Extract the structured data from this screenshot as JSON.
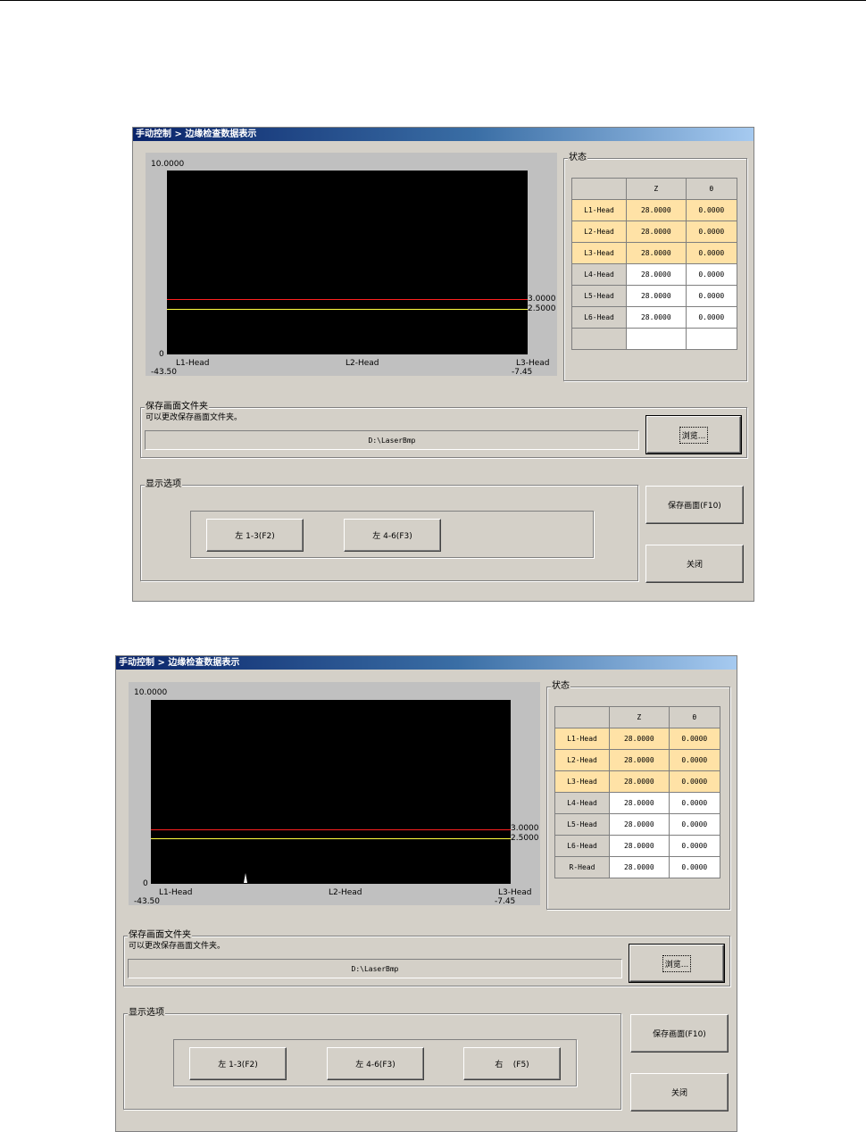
{
  "windows": [
    {
      "title": "手动控制 > 边缘检查数据表示",
      "plot": {
        "y_max": "10.0000",
        "y_min": "0",
        "x_left": "-43.50",
        "x_right": "-7.45",
        "x_labels": [
          "L1-Head",
          "L2-Head",
          "L3-Head"
        ],
        "red_line_value": "3.0000",
        "yellow_line_value": "2.5000",
        "red_color": "#ff2020",
        "yellow_color": "#ffff40"
      },
      "status": {
        "label": "状态",
        "col_z": "Z",
        "col_theta": "θ",
        "rows": [
          {
            "head": "L1-Head",
            "z": "28.0000",
            "t": "0.0000"
          },
          {
            "head": "L2-Head",
            "z": "28.0000",
            "t": "0.0000"
          },
          {
            "head": "L3-Head",
            "z": "28.0000",
            "t": "0.0000"
          },
          {
            "head": "L4-Head",
            "z": "28.0000",
            "t": "0.0000"
          },
          {
            "head": "L5-Head",
            "z": "28.0000",
            "t": "0.0000"
          },
          {
            "head": "L6-Head",
            "z": "28.0000",
            "t": "0.0000"
          },
          {
            "head": "",
            "z": "",
            "t": ""
          }
        ]
      },
      "save_folder": {
        "label": "保存画面文件夹",
        "hint": "可以更改保存画面文件夹。",
        "path": "D:\\LaserBmp",
        "browse": "浏览..."
      },
      "display_options": {
        "label": "显示选项",
        "buttons": [
          "左 1-3(F2)",
          "左 4-6(F3)"
        ]
      },
      "save_screen": "保存画面(F10)",
      "close": "关闭"
    },
    {
      "title": "手动控制 > 边缘检查数据表示",
      "plot": {
        "y_max": "10.0000",
        "y_min": "0",
        "x_left": "-43.50",
        "x_right": "-7.45",
        "x_labels": [
          "L1-Head",
          "L2-Head",
          "L3-Head"
        ],
        "red_line_value": "3.0000",
        "yellow_line_value": "2.5000",
        "red_color": "#ff2020",
        "yellow_color": "#ffff40"
      },
      "status": {
        "label": "状态",
        "col_z": "Z",
        "col_theta": "θ",
        "rows": [
          {
            "head": "L1-Head",
            "z": "28.0000",
            "t": "0.0000"
          },
          {
            "head": "L2-Head",
            "z": "28.0000",
            "t": "0.0000"
          },
          {
            "head": "L3-Head",
            "z": "28.0000",
            "t": "0.0000"
          },
          {
            "head": "L4-Head",
            "z": "28.0000",
            "t": "0.0000"
          },
          {
            "head": "L5-Head",
            "z": "28.0000",
            "t": "0.0000"
          },
          {
            "head": "L6-Head",
            "z": "28.0000",
            "t": "0.0000"
          },
          {
            "head": "R-Head",
            "z": "28.0000",
            "t": "0.0000"
          }
        ]
      },
      "save_folder": {
        "label": "保存画面文件夹",
        "hint": "可以更改保存画面文件夹。",
        "path": "D:\\LaserBmp",
        "browse": "浏览..."
      },
      "display_options": {
        "label": "显示选项",
        "buttons": [
          "左 1-3(F2)",
          "左 4-6(F3)",
          "右    (F5)"
        ]
      },
      "save_screen": "保存画面(F10)",
      "close": "关闭"
    }
  ]
}
